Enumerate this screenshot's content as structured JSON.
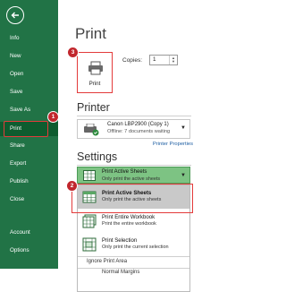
{
  "sidebar": {
    "items": [
      {
        "label": "Info"
      },
      {
        "label": "New"
      },
      {
        "label": "Open"
      },
      {
        "label": "Save"
      },
      {
        "label": "Save As"
      },
      {
        "label": "Print"
      },
      {
        "label": "Share"
      },
      {
        "label": "Export"
      },
      {
        "label": "Publish"
      },
      {
        "label": "Close"
      },
      {
        "label": "Account"
      },
      {
        "label": "Options"
      }
    ]
  },
  "badges": [
    "1",
    "2",
    "3"
  ],
  "main": {
    "title": "Print",
    "print_button_label": "Print",
    "copies": {
      "label": "Copies:",
      "value": "1"
    },
    "printer": {
      "heading": "Printer",
      "name": "Canon LBP2900 (Copy 1)",
      "status": "Offline: 7 documents waiting",
      "properties_link": "Printer Properties"
    },
    "settings": {
      "heading": "Settings",
      "selected_title": "Print Active Sheets",
      "selected_subtitle": "Only print the active sheets",
      "options": [
        {
          "title": "Print Active Sheets",
          "subtitle": "Only print the active sheets"
        },
        {
          "title": "Print Entire Workbook",
          "subtitle": "Print the entire workbook"
        },
        {
          "title": "Print Selection",
          "subtitle": "Only print the current selection"
        }
      ],
      "ignore_label": "Ignore Print Area",
      "last_item": "Normal Margins"
    }
  },
  "colors": {
    "sidebar": "#217346",
    "accent": "#e33b3b",
    "badge": "#c1272d",
    "dropdown": "#7dc383"
  }
}
